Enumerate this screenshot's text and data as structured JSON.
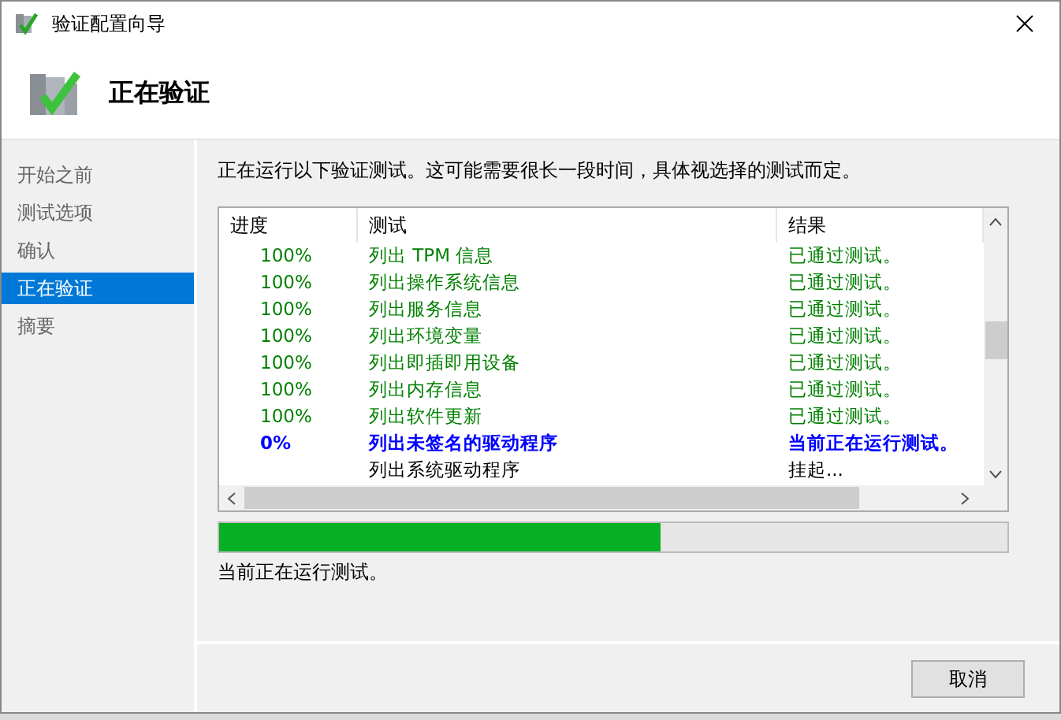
{
  "window": {
    "title": "验证配置向导"
  },
  "header": {
    "title": "正在验证"
  },
  "sidebar": {
    "items": [
      {
        "label": "开始之前",
        "selected": false
      },
      {
        "label": "测试选项",
        "selected": false
      },
      {
        "label": "确认",
        "selected": false
      },
      {
        "label": "正在验证",
        "selected": true
      },
      {
        "label": "摘要",
        "selected": false
      }
    ]
  },
  "intro": "正在运行以下验证测试。这可能需要很长一段时间，具体视选择的测试而定。",
  "table": {
    "columns": [
      "进度",
      "测试",
      "结果"
    ],
    "rows": [
      {
        "progress": "100%",
        "test": "列出 TPM 信息",
        "result": "已通过测试。",
        "kind": "passed"
      },
      {
        "progress": "100%",
        "test": "列出操作系统信息",
        "result": "已通过测试。",
        "kind": "passed"
      },
      {
        "progress": "100%",
        "test": "列出服务信息",
        "result": "已通过测试。",
        "kind": "passed"
      },
      {
        "progress": "100%",
        "test": "列出环境变量",
        "result": "已通过测试。",
        "kind": "passed"
      },
      {
        "progress": "100%",
        "test": "列出即插即用设备",
        "result": "已通过测试。",
        "kind": "passed"
      },
      {
        "progress": "100%",
        "test": "列出内存信息",
        "result": "已通过测试。",
        "kind": "passed"
      },
      {
        "progress": "100%",
        "test": "列出软件更新",
        "result": "已通过测试。",
        "kind": "passed"
      },
      {
        "progress": "0%",
        "test": "列出未签名的驱动程序",
        "result": "当前正在运行测试。",
        "kind": "running"
      },
      {
        "test": "列出系统驱动程序",
        "result": "挂起...",
        "kind": "pending"
      }
    ]
  },
  "progress": {
    "level": 0.56,
    "status": "当前正在运行测试。"
  },
  "buttons": [
    "取消"
  ]
}
